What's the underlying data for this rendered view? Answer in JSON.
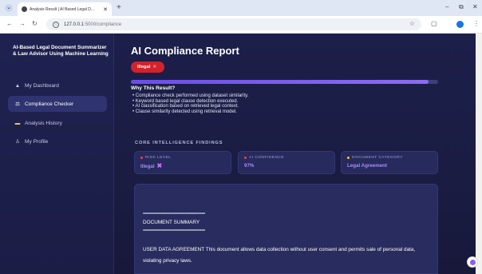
{
  "browser": {
    "tab_title": "Analysis Result | AI Based Legal D…",
    "url_host": "127.0.0.1",
    "url_rest": ":5000/compliance"
  },
  "sidebar": {
    "brand": "AI-Based Legal Document Summarizer & Law Advisor Using Machine Learning",
    "items": [
      {
        "label": "My Dashboard",
        "icon": "home-icon"
      },
      {
        "label": "Compliance Checker",
        "icon": "scale-icon"
      },
      {
        "label": "Analysis History",
        "icon": "folder-icon"
      },
      {
        "label": "My Profile",
        "icon": "user-icon"
      }
    ]
  },
  "report": {
    "title": "AI Compliance Report",
    "badge": "Illegal",
    "confidence_fraction": 0.97,
    "why_title": "Why This Result?",
    "reasons": [
      "Compliance check performed using dataset similarity.",
      "Keyword based legal clause detection executed.",
      "AI classification based on retrieved legal context.",
      "Clause similarity detected using retrieval model."
    ]
  },
  "findings": {
    "section_title": "CORE INTELLIGENCE FINDINGS",
    "cards": [
      {
        "label": "RISK LEVEL",
        "value": "Illegal",
        "color": "#ef4444"
      },
      {
        "label": "AI CONFIDENCE",
        "value": "97%",
        "color": "#a78bfa"
      },
      {
        "label": "DOCUMENT CATEGORY",
        "value": "Legal Agreement",
        "color": "#facc15"
      }
    ]
  },
  "document": {
    "separator": "================================",
    "heading": "DOCUMENT SUMMARY",
    "text_line_1": "USER DATA AGREEMENT This document allows data collection without user consent and permits sale of personal data,",
    "text_line_2": "violating privacy laws."
  },
  "colors": {
    "accent": "#8b6cf3",
    "danger": "#d2232c",
    "background": "#1c1f4a"
  }
}
